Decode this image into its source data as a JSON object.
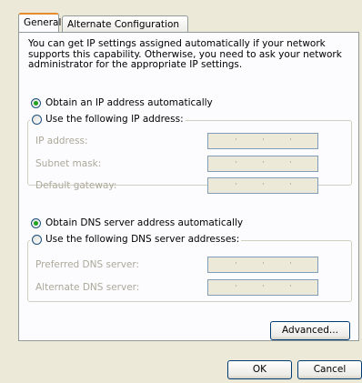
{
  "tabs": [
    {
      "label": "General",
      "active": true
    },
    {
      "label": "Alternate Configuration",
      "active": false
    }
  ],
  "description": "You can get IP settings assigned automatically if your network supports this capability. Otherwise, you need to ask your network administrator for the appropriate IP settings.",
  "ip": {
    "auto_label": "Obtain an IP address automatically",
    "auto_selected": true,
    "manual_label": "Use the following IP address:",
    "fields": [
      {
        "label": "IP address:",
        "value": "",
        "enabled": false
      },
      {
        "label": "Subnet mask:",
        "value": "",
        "enabled": false
      },
      {
        "label": "Default gateway:",
        "value": "",
        "enabled": false
      }
    ]
  },
  "dns": {
    "auto_label": "Obtain DNS server address automatically",
    "auto_selected": true,
    "manual_label": "Use the following DNS server addresses:",
    "fields": [
      {
        "label": "Preferred DNS server:",
        "value": "",
        "enabled": false
      },
      {
        "label": "Alternate DNS server:",
        "value": "",
        "enabled": false
      }
    ]
  },
  "buttons": {
    "advanced": "Advanced...",
    "ok": "OK",
    "cancel": "Cancel"
  },
  "colors": {
    "dialog_bg": "#ece9d8",
    "panel_bg": "#fcfcfe",
    "radio_checked": "#21a121",
    "disabled_text": "#aca899",
    "tab_highlight": "#e68b2c"
  }
}
